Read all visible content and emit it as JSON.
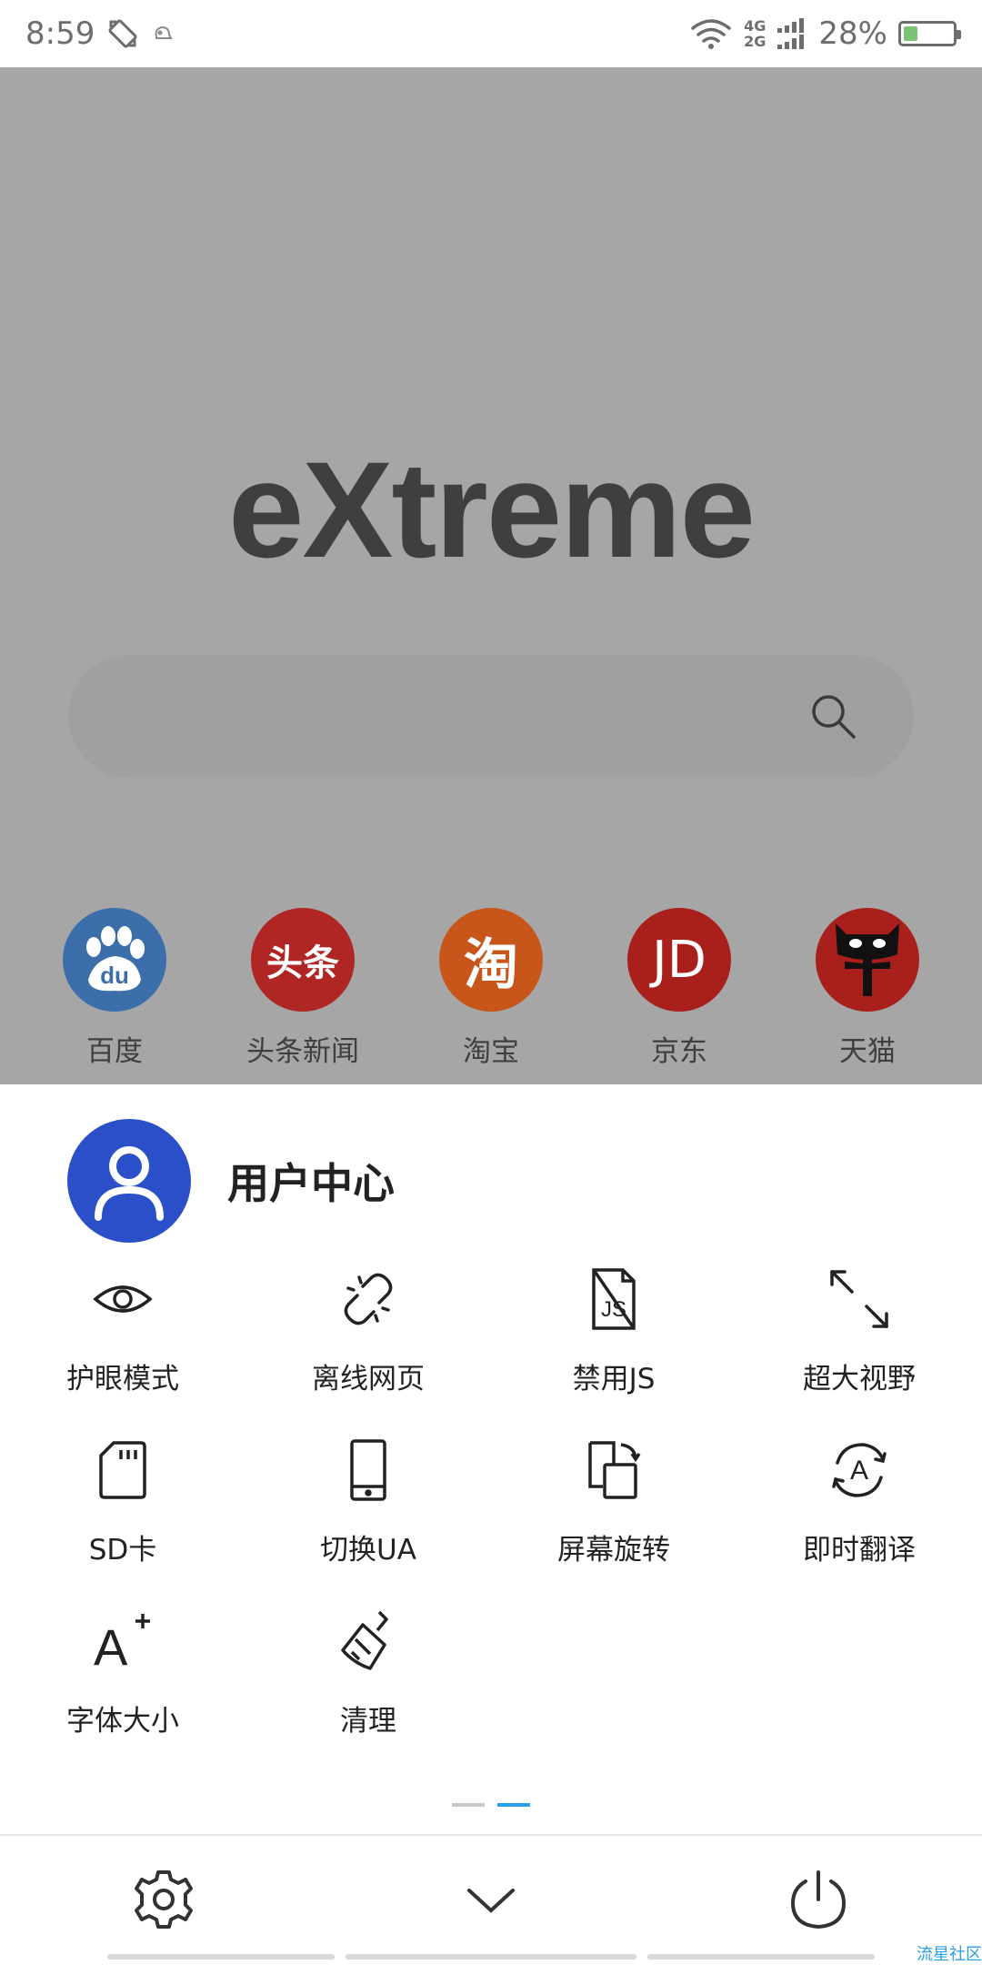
{
  "status_bar": {
    "time": "8:59",
    "net_top": "4G",
    "net_bottom": "2G",
    "battery": "28%",
    "battery_level": 0.28
  },
  "home": {
    "logo": "eXtreme",
    "search_placeholder": "",
    "shortcuts": [
      {
        "label": "百度",
        "icon": "baidu-icon",
        "color": "#3c6fa9",
        "glyph": "du"
      },
      {
        "label": "头条新闻",
        "icon": "toutiao-icon",
        "color": "#b02624",
        "glyph": "头条"
      },
      {
        "label": "淘宝",
        "icon": "taobao-icon",
        "color": "#c8561b",
        "glyph": "淘"
      },
      {
        "label": "京东",
        "icon": "jd-icon",
        "color": "#a81f1c",
        "glyph": "JD"
      },
      {
        "label": "天猫",
        "icon": "tmall-icon",
        "color": "#a81f1c",
        "glyph": ""
      }
    ]
  },
  "sheet": {
    "user_center": "用户中心",
    "items": [
      {
        "label": "护眼模式",
        "icon": "eye-icon"
      },
      {
        "label": "离线网页",
        "icon": "broken-link-icon"
      },
      {
        "label": "禁用JS",
        "icon": "js-file-icon"
      },
      {
        "label": "超大视野",
        "icon": "expand-icon"
      },
      {
        "label": "SD卡",
        "icon": "sd-card-icon"
      },
      {
        "label": "切换UA",
        "icon": "phone-icon"
      },
      {
        "label": "屏幕旋转",
        "icon": "rotate-screen-icon"
      },
      {
        "label": "即时翻译",
        "icon": "translate-icon"
      },
      {
        "label": "字体大小",
        "icon": "font-size-icon"
      },
      {
        "label": "清理",
        "icon": "broom-icon"
      }
    ],
    "corner_text": "流星社区"
  },
  "colors": {
    "accent": "#2aa0e8",
    "avatar": "#2b4fc8",
    "dim_bg": "#a6a6a6"
  }
}
